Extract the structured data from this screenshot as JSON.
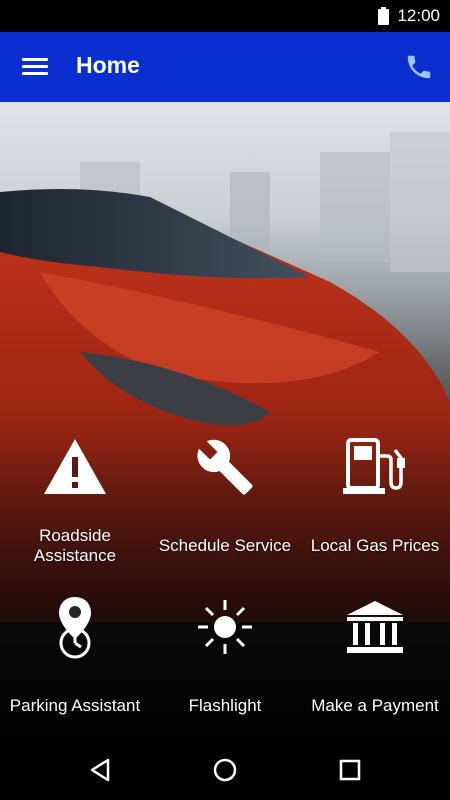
{
  "status_bar": {
    "time": "12:00",
    "icon": "battery-icon"
  },
  "app_bar": {
    "title": "Home",
    "menu_icon": "menu-icon",
    "call_icon": "phone-icon",
    "color": "#0a2ecf"
  },
  "tiles": [
    {
      "label": "Roadside Assistance",
      "icon": "warning-icon"
    },
    {
      "label": "Schedule Service",
      "icon": "wrench-icon"
    },
    {
      "label": "Local Gas Prices",
      "icon": "gas-pump-icon"
    },
    {
      "label": "Parking Assistant",
      "icon": "location-pin-icon"
    },
    {
      "label": "Flashlight",
      "icon": "sun-icon"
    },
    {
      "label": "Make a Payment",
      "icon": "bank-icon"
    }
  ],
  "nav_bar": {
    "back": "back-icon",
    "home": "home-icon",
    "recents": "recents-icon"
  }
}
